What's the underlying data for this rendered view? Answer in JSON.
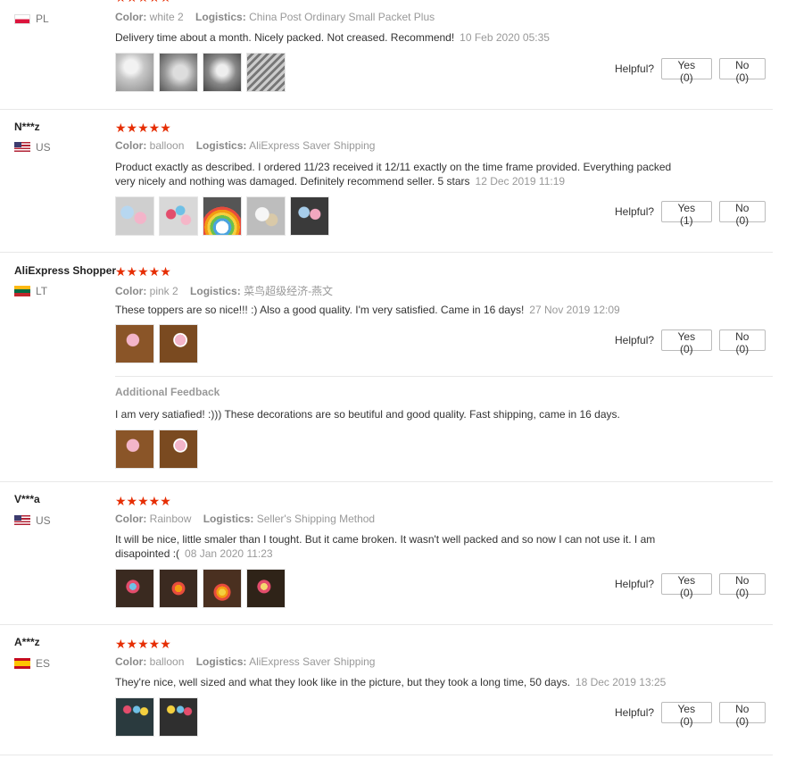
{
  "colors": {
    "star": "#e62e04",
    "divider": "#e8e8e8"
  },
  "reviews": [
    {
      "name": "",
      "country": "PL",
      "flag": "flag-pl",
      "stars": "★★★★★",
      "color_label": "Color:",
      "color_value": "white 2",
      "logistics_label": "Logistics:",
      "logistics_value": "China Post Ordinary Small Packet Plus",
      "text": "Delivery time about a month. Nicely packed. Not creased. Recommend!",
      "date": "10 Feb 2020 05:35",
      "helpful_label": "Helpful?",
      "yes": "Yes (0)",
      "no": "No (0)"
    },
    {
      "name": "N***z",
      "country": "US",
      "flag": "flag-us",
      "stars": "★★★★★",
      "color_label": "Color:",
      "color_value": "balloon",
      "logistics_label": "Logistics:",
      "logistics_value": "AliExpress Saver Shipping",
      "text": "Product exactly as described. I ordered 11/23 received it 12/11 exactly on the time frame provided. Everything packed very nicely and nothing was damaged. Definitely recommend seller. 5 stars",
      "date": "12 Dec 2019 11:19",
      "helpful_label": "Helpful?",
      "yes": "Yes (1)",
      "no": "No (0)"
    },
    {
      "name": "AliExpress Shopper",
      "country": "LT",
      "flag": "flag-lt",
      "stars": "★★★★★",
      "color_label": "Color:",
      "color_value": "pink 2",
      "logistics_label": "Logistics:",
      "logistics_value": "菜鸟超级经济-燕文",
      "text": "These toppers are so nice!!! :) Also a good quality. I'm very satisfied. Came in 16 days!",
      "date": "27 Nov 2019 12:09",
      "helpful_label": "Helpful?",
      "yes": "Yes (0)",
      "no": "No (0)",
      "additional_title": "Additional Feedback",
      "additional_text": "I am very satiafied! :))) These decorations are so beutiful and good quality. Fast shipping, came in 16 days."
    },
    {
      "name": "V***a",
      "country": "US",
      "flag": "flag-us",
      "stars": "★★★★★",
      "color_label": "Color:",
      "color_value": "Rainbow",
      "logistics_label": "Logistics:",
      "logistics_value": "Seller's Shipping Method",
      "text": "It will be nice, little smaler than I tought. But it came broken. It wasn't well packed and so now I can not use it. I am disapointed :(",
      "date": "08 Jan 2020 11:23",
      "helpful_label": "Helpful?",
      "yes": "Yes (0)",
      "no": "No (0)"
    },
    {
      "name": "A***z",
      "country": "ES",
      "flag": "flag-es",
      "stars": "★★★★★",
      "color_label": "Color:",
      "color_value": "balloon",
      "logistics_label": "Logistics:",
      "logistics_value": "AliExpress Saver Shipping",
      "text": "They're nice, well sized and what they look like in the picture, but they took a long time, 50 days.",
      "date": "18 Dec 2019 13:25",
      "helpful_label": "Helpful?",
      "yes": "Yes (0)",
      "no": "No (0)"
    }
  ]
}
